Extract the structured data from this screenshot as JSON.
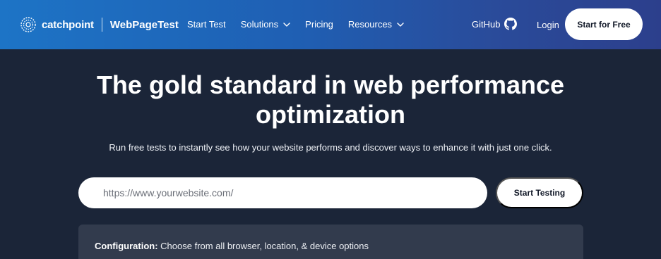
{
  "header": {
    "brand_name": "catchpoint",
    "product_name": "WebPageTest",
    "nav": [
      {
        "label": "Start Test",
        "dropdown": false
      },
      {
        "label": "Solutions",
        "dropdown": true
      },
      {
        "label": "Pricing",
        "dropdown": false
      },
      {
        "label": "Resources",
        "dropdown": true
      }
    ],
    "github_label": "GitHub",
    "login_label": "Login",
    "cta_label": "Start for Free",
    "gradient_colors": [
      "#1d74c6",
      "#2c3f8c"
    ]
  },
  "hero": {
    "title_line1": "The gold standard in web performance",
    "title_line2": "optimization",
    "subtitle": "Run free tests to instantly see how your website performs and discover ways to enhance it with just one click.",
    "url_placeholder": "https://www.yourwebsite.com/",
    "start_button_label": "Start Testing"
  },
  "config": {
    "label": "Configuration:",
    "text": "Choose from all browser, location, & device options"
  },
  "colors": {
    "background": "#1b2538",
    "panel": "#323b4d",
    "button_bg": "#ffffff"
  },
  "icons": {
    "brand": "catchpoint-logo-icon",
    "chevron": "chevron-down-icon",
    "github": "github-icon"
  }
}
